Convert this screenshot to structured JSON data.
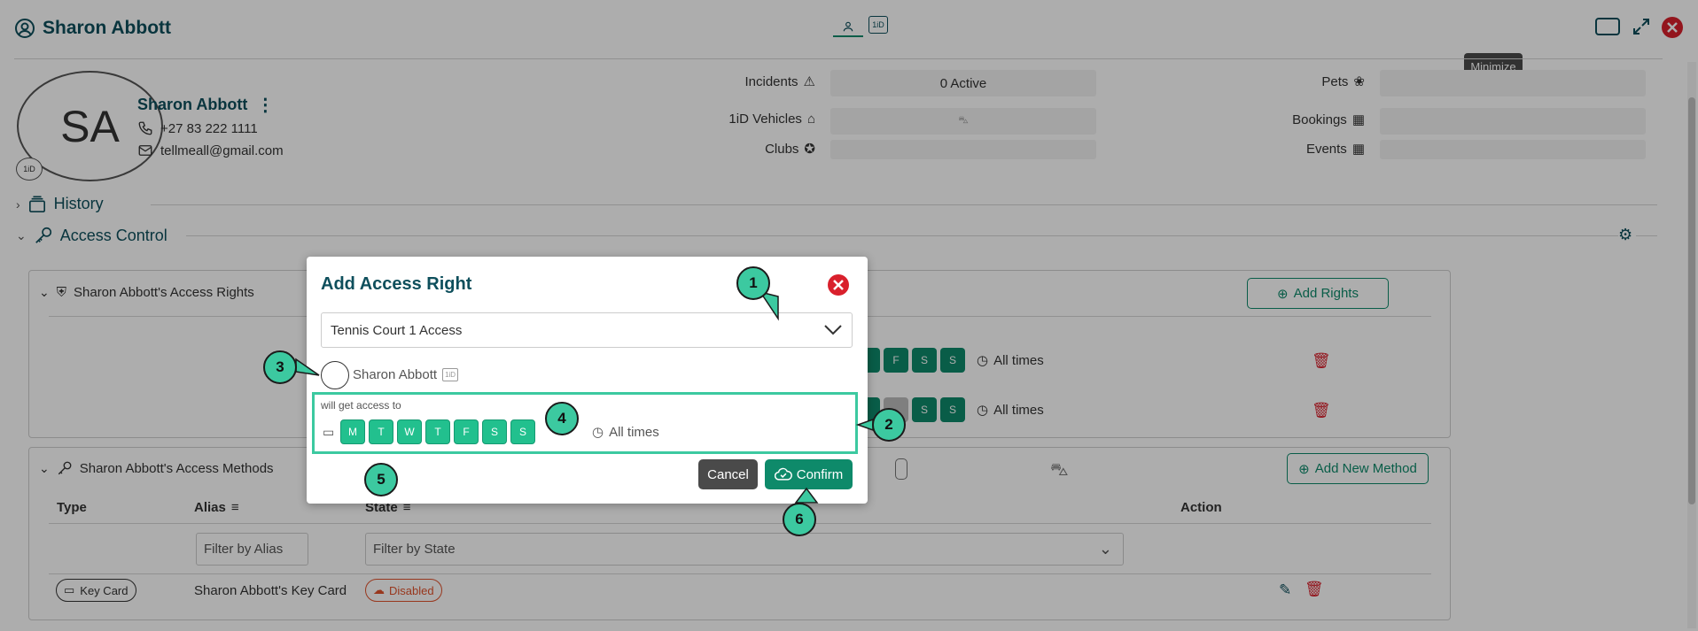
{
  "header": {
    "title": "Sharon Abbott",
    "tooltip": "Minimize"
  },
  "profile": {
    "initials": "SA",
    "badge": "1iD",
    "name": "Sharon Abbott",
    "phone": "+27 83 222 1111",
    "email": "tellmeall@gmail.com"
  },
  "stats": {
    "incidents_label": "Incidents",
    "incidents_value": "0 Active",
    "vehicles_label": "1iD Vehicles",
    "clubs_label": "Clubs",
    "pets_label": "Pets",
    "bookings_label": "Bookings",
    "events_label": "Events"
  },
  "sections": {
    "history": "History",
    "access_control": "Access Control"
  },
  "rights_panel": {
    "title": "Sharon Abbott's Access Rights",
    "add_button": "Add Rights",
    "rows": [
      {
        "days": [
          "F",
          "S",
          "S"
        ],
        "times": "All times"
      },
      {
        "days": [
          "",
          "S",
          "S"
        ],
        "times": "All times"
      }
    ]
  },
  "methods_panel": {
    "title": "Sharon Abbott's Access Methods",
    "add_button": "Add New Method",
    "columns": {
      "type": "Type",
      "alias": "Alias",
      "state": "State",
      "action": "Action"
    },
    "filter_alias_placeholder": "Filter by Alias",
    "filter_state_placeholder": "Filter by State",
    "row": {
      "type": "Key Card",
      "alias": "Sharon Abbott's Key Card",
      "state": "Disabled"
    }
  },
  "modal": {
    "title": "Add Access Right",
    "selected": "Tennis Court 1 Access",
    "person": "Sharon Abbott",
    "person_badge": "1iD",
    "access_label": "will get access to",
    "days": [
      "M",
      "T",
      "W",
      "T",
      "F",
      "S",
      "S"
    ],
    "times": "All times",
    "cancel": "Cancel",
    "confirm": "Confirm"
  },
  "callouts": [
    "1",
    "2",
    "3",
    "4",
    "5",
    "6"
  ],
  "colors": {
    "brand": "#0e4f5c",
    "accent": "#0e8a6a",
    "callout": "#3cc9a0",
    "danger": "#d9202c"
  }
}
